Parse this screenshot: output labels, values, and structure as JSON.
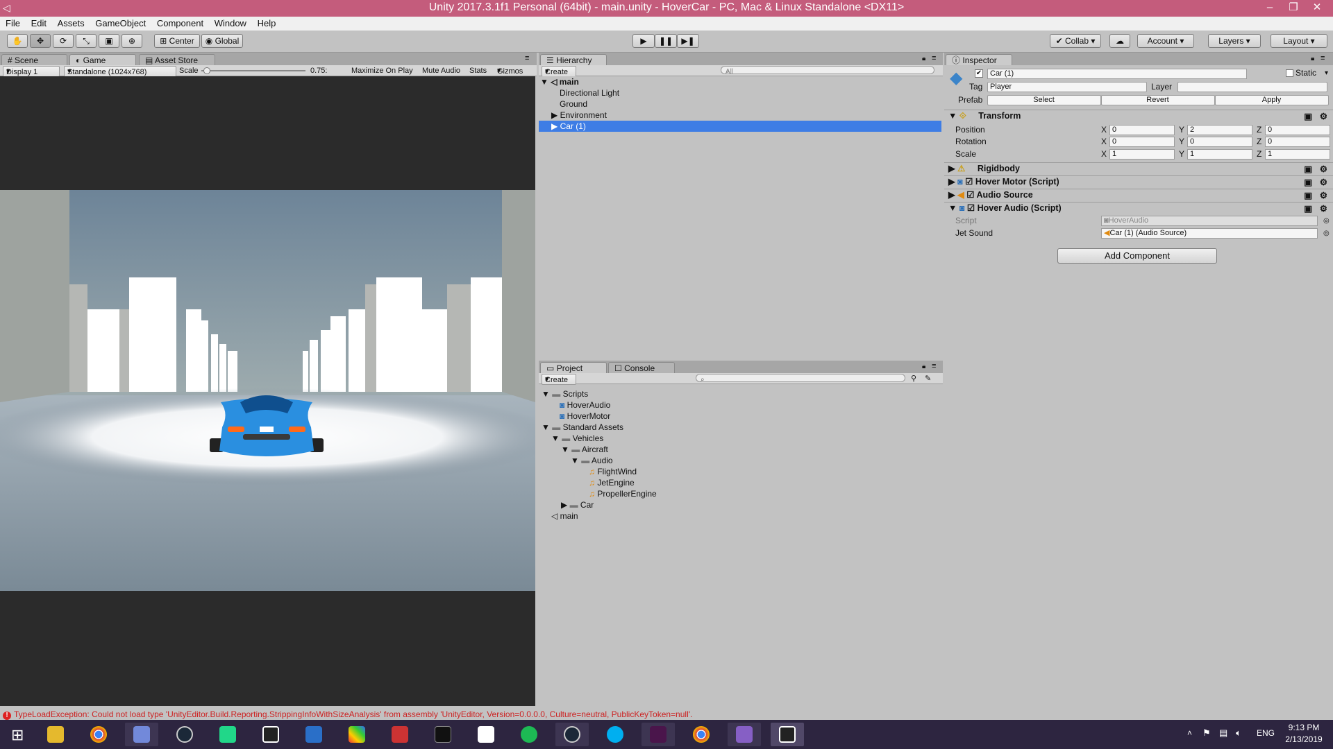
{
  "window": {
    "title": "Unity 2017.3.1f1 Personal (64bit) - main.unity - HoverCar - PC, Mac & Linux Standalone <DX11>",
    "minimize": "–",
    "maximize": "❐",
    "close": "✕"
  },
  "menu": [
    "File",
    "Edit",
    "Assets",
    "GameObject",
    "Component",
    "Window",
    "Help"
  ],
  "toolbar": {
    "pivot": "Center",
    "space": "Global",
    "collab": "Collab",
    "account": "Account",
    "layers": "Layers",
    "layout": "Layout"
  },
  "scene_tabs": [
    "Scene",
    "Game",
    "Asset Store"
  ],
  "game_bar": {
    "display": "Display 1",
    "resolution": "Standalone (1024x768)",
    "scale_label": "Scale",
    "scale_value": "0.75:",
    "scale_fraction": 0.75,
    "maximize": "Maximize On Play",
    "mute": "Mute Audio",
    "stats": "Stats",
    "gizmos": "Gizmos"
  },
  "hierarchy": {
    "tab": "Hierarchy",
    "create": "Create",
    "search_placeholder": "All",
    "scene": "main",
    "items": [
      "Directional Light",
      "Ground",
      "Environment",
      "Car (1)"
    ]
  },
  "project": {
    "tabs": [
      "Project",
      "Console"
    ],
    "create": "Create",
    "tree": [
      "Scripts",
      "HoverAudio",
      "HoverMotor",
      "Standard Assets",
      "Vehicles",
      "Aircraft",
      "Audio",
      "FlightWind",
      "JetEngine",
      "PropellerEngine",
      "Car",
      "main"
    ]
  },
  "inspector": {
    "tab": "Inspector",
    "object_name": "Car (1)",
    "static": "Static",
    "tag_label": "Tag",
    "tag_value": "Player",
    "layer_label": "Layer",
    "prefab_label": "Prefab",
    "prefab_select": "Select",
    "prefab_revert": "Revert",
    "prefab_apply": "Apply",
    "transform": {
      "title": "Transform",
      "position_label": "Position",
      "rotation_label": "Rotation",
      "scale_label": "Scale",
      "axis_x": "X",
      "axis_y": "Y",
      "axis_z": "Z",
      "position": [
        "0",
        "2",
        "0"
      ],
      "rotation": [
        "0",
        "0",
        "0"
      ],
      "scale": [
        "1",
        "1",
        "1"
      ]
    },
    "components": [
      "Rigidbody",
      "Hover Motor (Script)",
      "Audio Source",
      "Hover Audio (Script)"
    ],
    "script_label": "Script",
    "script_value": "HoverAudio",
    "jet_label": "Jet Sound",
    "jet_value": "Car (1) (Audio Source)",
    "add_component": "Add Component"
  },
  "status_error": "TypeLoadException: Could not load type 'UnityEditor.Build.Reporting.StrippingInfoWithSizeAnalysis' from assembly 'UnityEditor, Version=0.0.0.0, Culture=neutral, PublicKeyToken=null'.",
  "taskbar": {
    "lang": "ENG",
    "time": "9:13 PM",
    "date": "2/13/2019"
  },
  "colors": {
    "titlebar": "#c45c7c",
    "selection": "#3e7de5",
    "taskbar": "#2d2540",
    "car": "#2a8fe0"
  }
}
